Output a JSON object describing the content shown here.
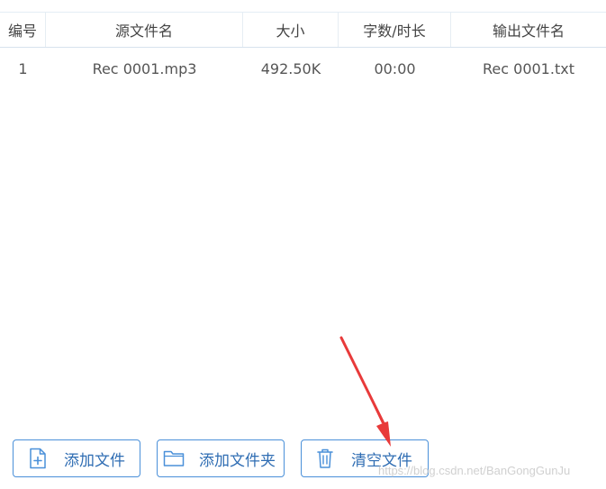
{
  "table": {
    "columns": [
      "编号",
      "源文件名",
      "大小",
      "字数/时长",
      "输出文件名"
    ],
    "rows": [
      {
        "no": "1",
        "source": "Rec 0001.mp3",
        "size": "492.50K",
        "duration": "00:00",
        "output": "Rec 0001.txt"
      }
    ]
  },
  "toolbar": {
    "add_file": "添加文件",
    "add_folder": "添加文件夹",
    "clear_files": "清空文件"
  },
  "icons": {
    "add_file": "file-plus-icon",
    "add_folder": "folder-icon",
    "clear_files": "trash-icon"
  },
  "colors": {
    "accent": "#4a90d9",
    "annotation_arrow": "#e83a3a"
  },
  "watermark": "https://blog.csdn.net/BanGongGunJu"
}
